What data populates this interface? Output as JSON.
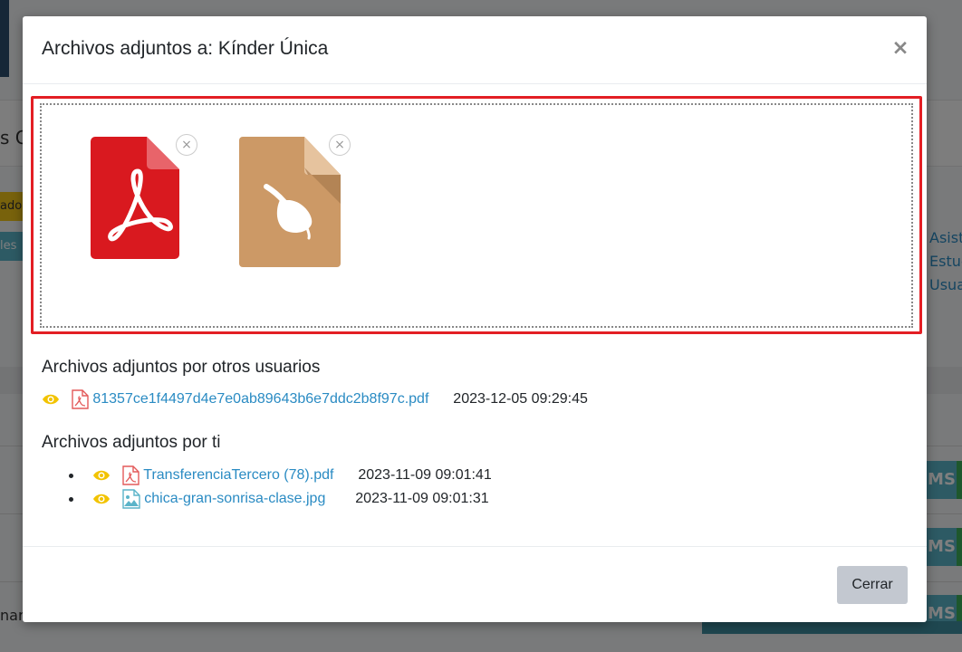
{
  "modal": {
    "title": "Archivos adjuntos a: Kínder Única",
    "close_symbol": "×",
    "remove_symbol": "×"
  },
  "dropzone": {
    "files": [
      {
        "type": "pdf",
        "icon": "pdf-file-icon",
        "color": "#d9191f"
      },
      {
        "type": "image",
        "icon": "image-file-icon",
        "color": "#cc9966"
      }
    ]
  },
  "other_users": {
    "heading": "Archivos adjuntos por otros usuarios",
    "files": [
      {
        "name": "81357ce1f4497d4e7e0ab89643b6e7ddc2b8f97c.pdf",
        "date": "2023-12-05 09:29:45",
        "icon": "pdf-icon"
      }
    ]
  },
  "mine": {
    "heading": "Archivos adjuntos por ti",
    "files": [
      {
        "name": "TransferenciaTercero (78).pdf",
        "date": "2023-11-09 09:01:41",
        "icon": "pdf-icon"
      },
      {
        "name": "chica-gran-sonrisa-clase.jpg",
        "date": "2023-11-09 09:01:31",
        "icon": "image-icon"
      }
    ]
  },
  "footer": {
    "close_label": "Cerrar"
  },
  "background": {
    "title_fragment": "s G",
    "tag1": "ado",
    "tag2": "les c",
    "links": [
      "Asist",
      "Estuc",
      "Usua"
    ],
    "button_text": "MS",
    "left_text": "nari"
  },
  "colors": {
    "accent_link": "#2a8bc3",
    "highlight_border": "#e31e24",
    "eye": "#f2c300",
    "pdf": "#d9191f",
    "image": "#5bb4c9"
  }
}
